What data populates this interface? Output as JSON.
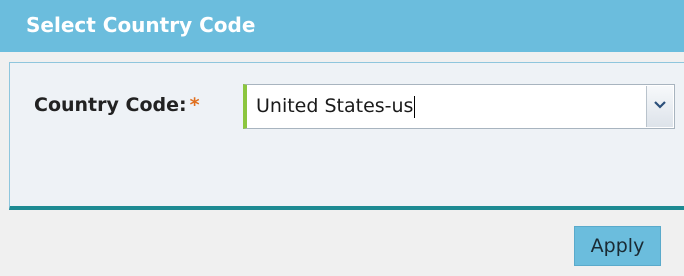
{
  "dialog": {
    "title": "Select Country Code"
  },
  "form": {
    "country_code_label": "Country Code:",
    "required_marker": "*",
    "country_code_value": "United States-us"
  },
  "footer": {
    "apply_label": "Apply"
  },
  "colors": {
    "title_bar": "#6bbddd",
    "required_marker": "#e07020",
    "select_focus_accent": "#8cc63f",
    "panel_bottom_border": "#1c8a92",
    "apply_button": "#6bbddd"
  },
  "icons": {
    "dropdown": "chevron-down-icon"
  }
}
